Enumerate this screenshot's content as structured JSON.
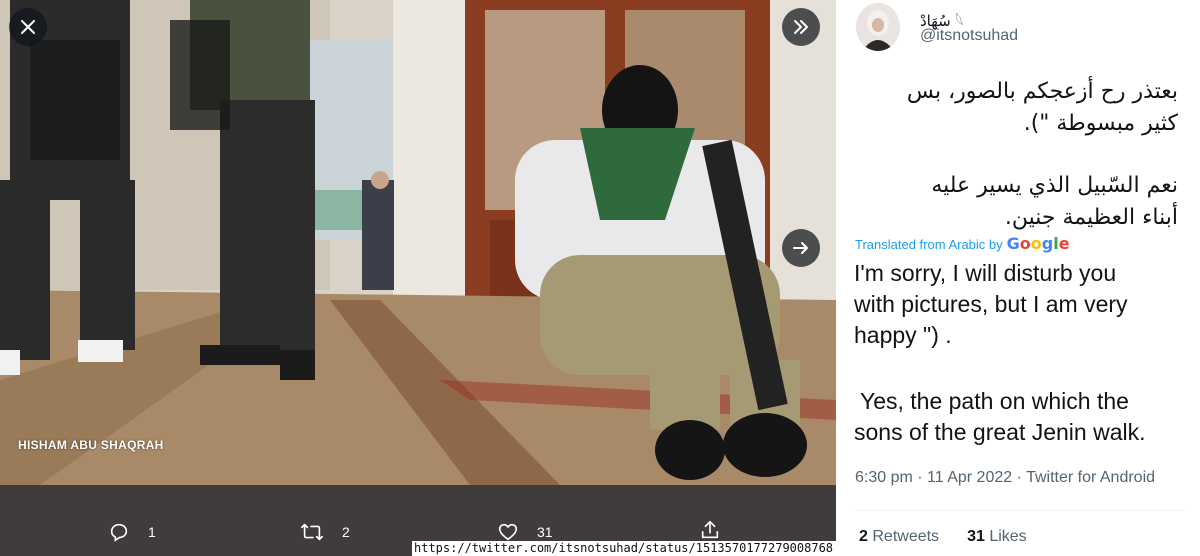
{
  "viewer": {
    "close_icon": "close-icon",
    "expand_icon": "double-chevron-right-icon",
    "next_icon": "arrow-right-icon",
    "photo_credit": "HISHAM ABU SHAQRAH",
    "actions": {
      "reply": {
        "icon": "reply-icon",
        "count": "1"
      },
      "retweet": {
        "icon": "retweet-icon",
        "count": "2"
      },
      "like": {
        "icon": "heart-icon",
        "count": "31"
      },
      "share": {
        "icon": "share-icon"
      }
    },
    "url": "https://twitter.com/itsnotsuhad/status/1513570177279008768"
  },
  "tweet": {
    "display_name": "سُهَادْ 𓆩",
    "handle": "@itsnotsuhad",
    "arabic_lines": [
      "بعتذر رح أزعجكم بالصور، بس",
      "كثير مبسوطة \").",
      "نعم السّبيل الذي يسير عليه",
      "أبناء العظيمة جنين."
    ],
    "translated_from": "Translated from Arabic by",
    "translator": "Google",
    "translation_lines": [
      "I'm sorry, I will disturb you",
      "with pictures, but I am very",
      "happy \") .",
      " Yes, the path on which the",
      "sons of the great Jenin walk."
    ],
    "timestamp": "6:30 pm · 11 Apr 2022 · Twitter for Android",
    "retweets": {
      "count": "2",
      "label": "Retweets"
    },
    "likes": {
      "count": "31",
      "label": "Likes"
    }
  },
  "colors": {
    "link_blue": "#1d9bf0",
    "muted_text": "#536471",
    "primary_text": "#0f1419",
    "viewer_bar": "#403b3c"
  }
}
